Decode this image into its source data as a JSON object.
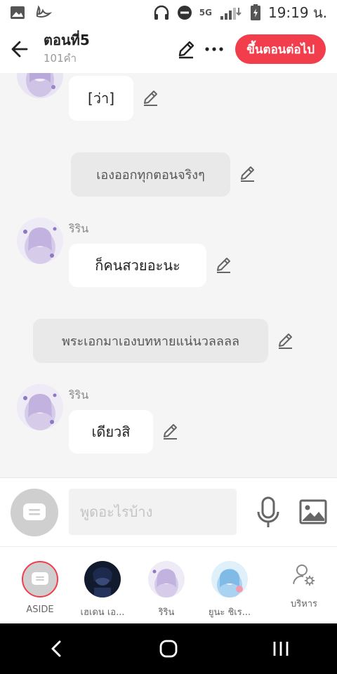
{
  "status_bar": {
    "network": "5G",
    "time": "19:19 น."
  },
  "header": {
    "title": "ตอนที่5",
    "word_count": "101คำ",
    "next_button": "ขึ้นตอนต่อไป"
  },
  "messages": [
    {
      "type": "character",
      "sender": "",
      "text": "[ว่า]"
    },
    {
      "type": "aside",
      "text": "เองออกทุกตอนจริงๆ"
    },
    {
      "type": "character",
      "sender": "ริริน",
      "text": "ก็คนสวยอะนะ"
    },
    {
      "type": "aside",
      "text": "พระเอกมาเองบทหายแน่นวลลลล"
    },
    {
      "type": "character",
      "sender": "ริริน",
      "text": "เดียวสิ"
    }
  ],
  "input": {
    "placeholder": "พูดอะไรบ้าง",
    "value": ""
  },
  "characters": [
    {
      "name": "ASIDE",
      "icon": "aside-icon"
    },
    {
      "name": "เฮเดน เอ...",
      "icon": "avatar"
    },
    {
      "name": "ริริน",
      "icon": "avatar"
    },
    {
      "name": "ยูนะ ชิเร...",
      "icon": "avatar"
    },
    {
      "name": "บริหาร",
      "icon": "manage-characters-icon"
    }
  ],
  "colors": {
    "accent": "#f23d4c",
    "aside_bubble": "#e9e9e9",
    "chat_bg": "#f5f5f5"
  }
}
